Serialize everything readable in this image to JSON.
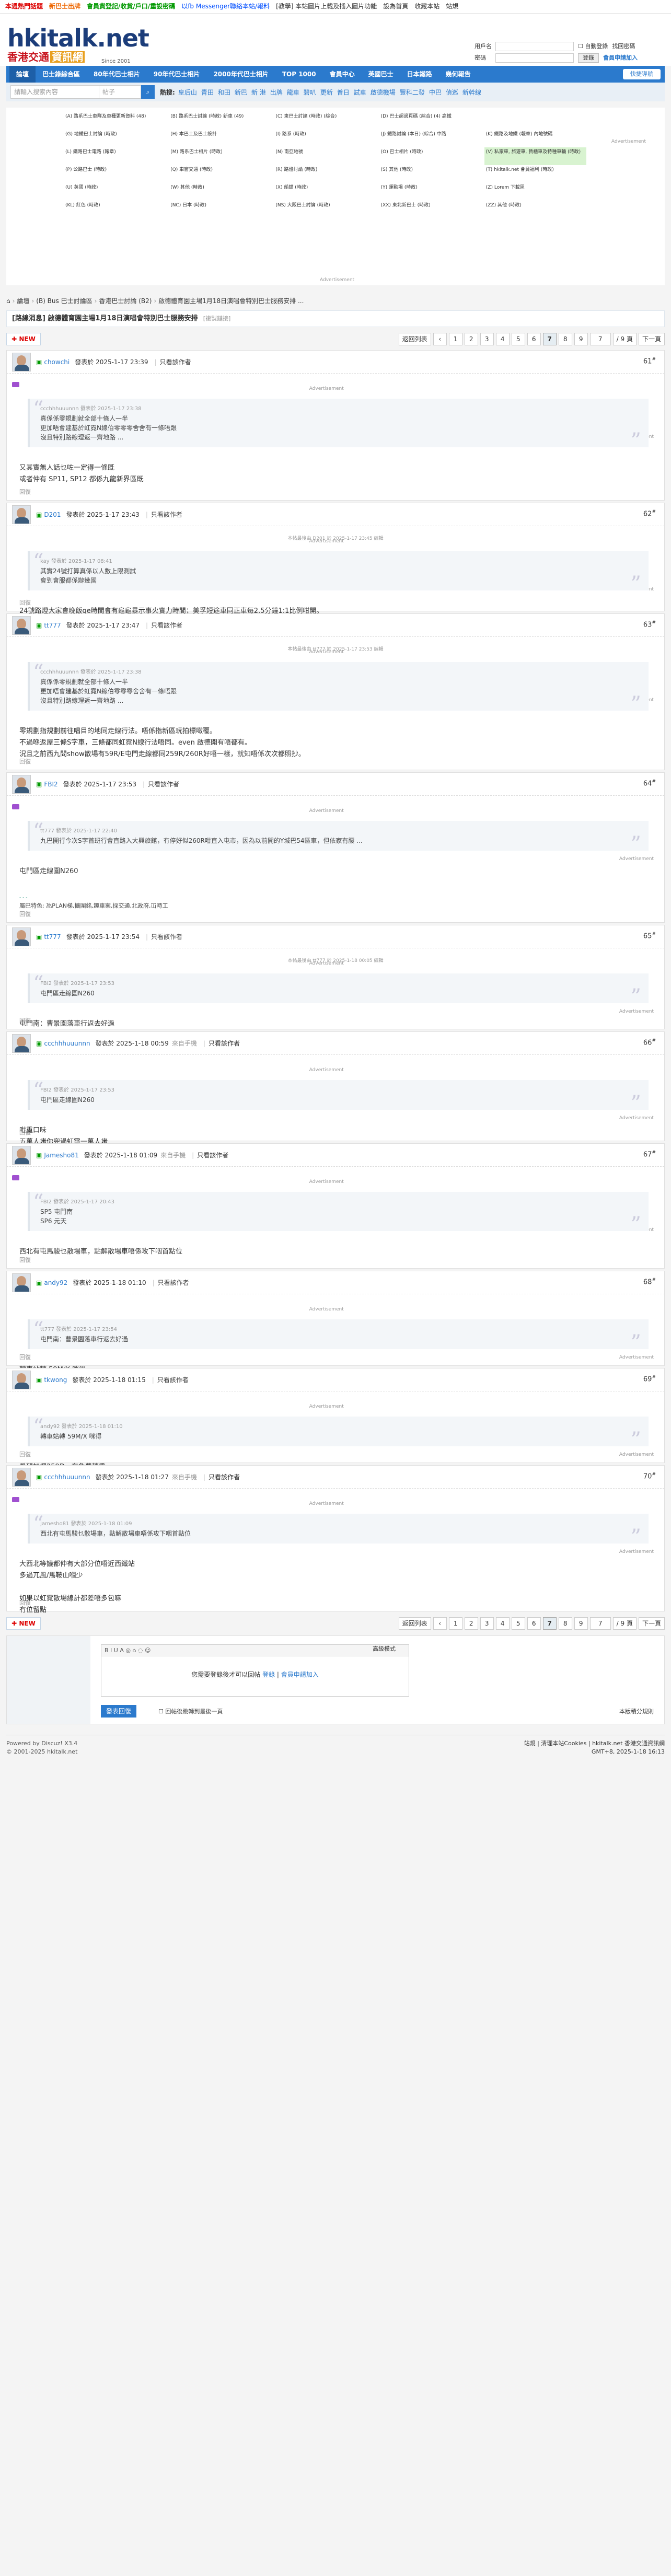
{
  "topbar": {
    "links": [
      {
        "label": "本週熱門話題",
        "style": "red"
      },
      {
        "label": "新巴士出牌",
        "style": "orange"
      },
      {
        "label": "會員貨登記/收貨/戶口/重設密碼",
        "style": "green"
      },
      {
        "label": "以fb Messenger聯絡本站/報料",
        "style": "blue"
      },
      {
        "label": "[教學] 本站圖片上載及插入圖片功能",
        "style": "plain"
      },
      {
        "label": "設為首頁",
        "style": "plain"
      },
      {
        "label": "收藏本站",
        "style": "plain"
      },
      {
        "label": "站規",
        "style": "plain"
      }
    ]
  },
  "logo": {
    "title": "hkitalk.net",
    "subtitle": "香港交通",
    "subtitle2": "資訊網",
    "since": "Since 2001"
  },
  "login": {
    "user_label": "用戶名",
    "pass_label": "密碼",
    "autologin": "自動登錄",
    "forgot": "找回密碼",
    "login_btn": "登錄",
    "register": "會員申請加入"
  },
  "nav": {
    "items": [
      "論壇",
      "巴士錄綜合區",
      "80年代巴士相片",
      "90年代巴士相片",
      "2000年代巴士相片",
      "TOP 1000",
      "會員中心",
      "英國巴士",
      "日本鐵路",
      "幾何報告"
    ],
    "active": 0,
    "quick": "快捷導航"
  },
  "search": {
    "placeholder": "請輸入搜索內容",
    "type": "帖子",
    "hot_label": "熱搜:",
    "hot": [
      "皇后山",
      "青田",
      "和田",
      "新巴",
      "新 港",
      "出牌",
      "龍車",
      "碧叭",
      "更新",
      "普日",
      "試車",
      "啟德機場",
      "豐科二發",
      "中巴",
      "偵巡",
      "新幹線"
    ]
  },
  "ads": {
    "label": "Advertisement",
    "cells": [
      "(A) 路系巴士車隊及車種更新資料 (48)",
      "(B) 路系巴士討論 (時政) 新車 (49)",
      "(C) 東巴士討論 (時政) (綜合)",
      "(D) 巴士超過頁碼 (綜合) (4) 高鐵",
      "",
      "(G) 地鐵巴士討論 (時政)",
      "(H) 本巴士及巴士設計",
      "(I) 路系 (時政)",
      "(J) 鐵路討論 (本日) (綜合) 中路",
      "(K) 鐵路及地鐵 (報章) 內地號碼",
      "(L) 鐵路巴士電路 (報章)",
      "(M) 路系巴士相片 (時政)",
      "(N) 南亞地號",
      "(O) 巴士相片 (時政)",
      "(V) 私家車, 旅遊車, 貨櫃車及特種車輛 (時政)",
      "(P) 公路巴士 (時政)",
      "(Q) 車窗交通 (時政)",
      "(R) 路燈討論 (時政)",
      "(S) 其他 (時政)",
      "(T) hkitalk.net 會員福利 (時政)",
      "(U) 英國 (時政)",
      "(W) 其他 (時政)",
      "(X) 船錨 (時政)",
      "(Y) 運動場 (時政)",
      "(Z) Lorem 下載區",
      "(KL) 紅色 (時政)",
      "(NC) 日本 (時政)",
      "(NS) 大阪巴士討論 (時政)",
      "(XX) 東北新巴士 (時政)",
      "(ZZ) 其他 (時政)"
    ],
    "highlight": 14
  },
  "breadcrumb": [
    "論壇",
    "(B) Bus 巴士討論區",
    "香港巴士討論 (B2)",
    "啟德體育園主場1月18日演唱會特別巴士服務安排 ..."
  ],
  "thread": {
    "title": "[路線消息] 啟德體育園主場1月18日演唱會特別巴士服務安排",
    "copy_link": "[複製鏈接]"
  },
  "pager": {
    "new_label": "NEW",
    "back": "返回列表",
    "pages": [
      "1",
      "2",
      "3",
      "4",
      "5",
      "6",
      "7",
      "8",
      "9"
    ],
    "current": "7",
    "input": "7",
    "total": "/ 9 頁",
    "next": "下一頁"
  },
  "posts": [
    {
      "user": "chowchi",
      "date": "發表於 2025-1-17 23:39",
      "via": "",
      "author_only": "只看該作者",
      "floor": "61",
      "quote_head": "ccchhhuuunnn 發表於 2025-1-17 23:38",
      "quote_lines": [
        "真係係零規劃就全部十條人一半",
        "更加唔會建基於虹霓N線伯零零零舍舍有一條唔跟",
        "沒且特別路線理返一齊地路 ..."
      ],
      "body": [
        "又其實無人話乜咗一定得一條既",
        "或者仲有 SP11, SP12 都係九龍新界區既"
      ],
      "sig": "",
      "edit": ""
    },
    {
      "user": "D201",
      "date": "發表於 2025-1-17 23:43",
      "via": "",
      "author_only": "只看該作者",
      "floor": "62",
      "quote_head": "kay 發表於 2025-1-17 08:41",
      "quote_lines": [
        "其實24號打算真係以人數上限測試",
        "會到會服都係辦幾國"
      ],
      "body": [
        "24號路燈大家會晚飯ge時間會有龜龜暴示事火實力時間；美孚短途車同正車每2.5分鐘1:1比例咁開。"
      ],
      "sig": "",
      "edit": "本帖最後由 D201 於 2025-1-17 23:45 編輯"
    },
    {
      "user": "tt777",
      "date": "發表於 2025-1-17 23:47",
      "via": "",
      "author_only": "只看該作者",
      "floor": "63",
      "quote_head": "ccchhhuuunnn 發表於 2025-1-17 23:38",
      "quote_lines": [
        "真係係零規劃就全部十條人一半",
        "更加唔會建基於虹霓N線伯零零零舍舍有一條唔跟",
        "沒且特別路線理返一齊地路 ..."
      ],
      "body": [
        "零規劃指規劃前往唱目的地同走線行法。唔係指新區玩拍標噉覆。",
        "不過喺返屋三條S字車，三條都同虹霓N線行法唔同。even 啟德開有唔都有。",
        "況且之前西九問show散場有59R/E屯門走線都同259R/260R好唔一樣，就知唔係次次都照抄。"
      ],
      "sig": "",
      "edit": "本帖最後由 tt777 於 2025-1-17 23:53 編輯"
    },
    {
      "user": "FBI2",
      "date": "發表於 2025-1-17 23:53",
      "via": "",
      "author_only": "只看該作者",
      "floor": "64",
      "quote_head": "tt777 發表於 2025-1-17 22:40",
      "quote_lines": [
        "九巴開行今次S字首班行會直路入大興旅館，冇停好似260R咁直入屯市，因為以前開的Y城巴54區車，但依家有腰 ..."
      ],
      "body": [
        "屯門區走線圍N260"
      ],
      "sig": "屬巴特色: 氹PLAN梯,擴圍銘,趣車案,採交通,北政府,冚時工",
      "edit": ""
    },
    {
      "user": "tt777",
      "date": "發表於 2025-1-17 23:54",
      "via": "",
      "author_only": "只看該作者",
      "floor": "65",
      "quote_head": "FBI2 發表於 2025-1-17 23:53",
      "quote_lines": [
        "屯門區走線圍N260"
      ],
      "body": [
        "屯門南：曹景園落車行返去好過"
      ],
      "sig": "",
      "edit": "本帖最後由 tt777 於 2025-1-18 00:05 編輯"
    },
    {
      "user": "ccchhhuuunnn",
      "date": "發表於 2025-1-18 00:59",
      "via": "來自手機",
      "author_only": "只看該作者",
      "floor": "66",
      "quote_head": "FBI2 發表於 2025-1-17 23:53",
      "quote_lines": [
        "屯門區走線圍N260"
      ],
      "body": [
        "咁重口味",
        "五萬人堵你兜過虹霓一萬人堵"
      ],
      "sig": "",
      "edit": ""
    },
    {
      "user": "Jamesho81",
      "date": "發表於 2025-1-18 01:09",
      "via": "來自手機",
      "author_only": "只看該作者",
      "floor": "67",
      "quote_head": "FBI2 發表於 2025-1-17 20:43",
      "quote_lines": [
        "SP5 屯門南",
        "SP6 元天"
      ],
      "body": [
        "西北有屯馬駿乜散場車，點解散場車唔係攻下咽首點位"
      ],
      "sig": "",
      "edit": ""
    },
    {
      "user": "andy92",
      "date": "發表於 2025-1-18 01:10",
      "via": "",
      "author_only": "只看該作者",
      "floor": "68",
      "quote_head": "tt777 發表於 2025-1-17 23:54",
      "quote_lines": [
        "屯門南：曹景園落車行返去好過"
      ],
      "body": [
        "轉車站轉 59M/X 咪得"
      ],
      "sig": "",
      "edit": ""
    },
    {
      "user": "tkwong",
      "date": "發表於 2025-1-18 01:15",
      "via": "",
      "author_only": "只看該作者",
      "floor": "69",
      "quote_head": "andy92 發表於 2025-1-18 01:10",
      "quote_lines": [
        "轉車站轉 59M/X 咪得"
      ],
      "body": [
        "希望加埋259D，有免費轉乘。"
      ],
      "sig": "",
      "edit": ""
    },
    {
      "user": "ccchhhuuunnn",
      "date": "發表於 2025-1-18 01:27",
      "via": "來自手機",
      "author_only": "只看該作者",
      "floor": "70",
      "quote_head": "Jamesho81 發表於 2025-1-18 01:09",
      "quote_lines": [
        "西北有屯馬駿乜散場車，點解散場車唔係攻下咽首點位"
      ],
      "body": [
        "大西北等議都仲有大部分位唔近西鐵站",
        "多過兀風/馬鞍山嗰少",
        "",
        "如果以虹霓散場線計都差唔多包嘛",
        "冇位留點"
      ],
      "sig": "",
      "edit": ""
    }
  ],
  "labels": {
    "ad": "Advertisement",
    "reply": "回復"
  },
  "editor": {
    "advanced": "高級模式",
    "tools": "B I U A ◎ ⌂ ◌ ☺",
    "prompt": "您需要登錄後才可以回帖",
    "login": "登錄",
    "register": "會員申請加入",
    "submit": "發表回復",
    "notice": "回帖後跳轉到最後一頁",
    "rules": "本版積分規則"
  },
  "footer": {
    "powered": "Powered by Discuz! X3.4",
    "copyright": "© 2001-2025 hkitalk.net",
    "right1": "站規 | 清理本站Cookies | hkitalk.net 香港交通資訊網",
    "right2": "GMT+8, 2025-1-18 16:13"
  }
}
